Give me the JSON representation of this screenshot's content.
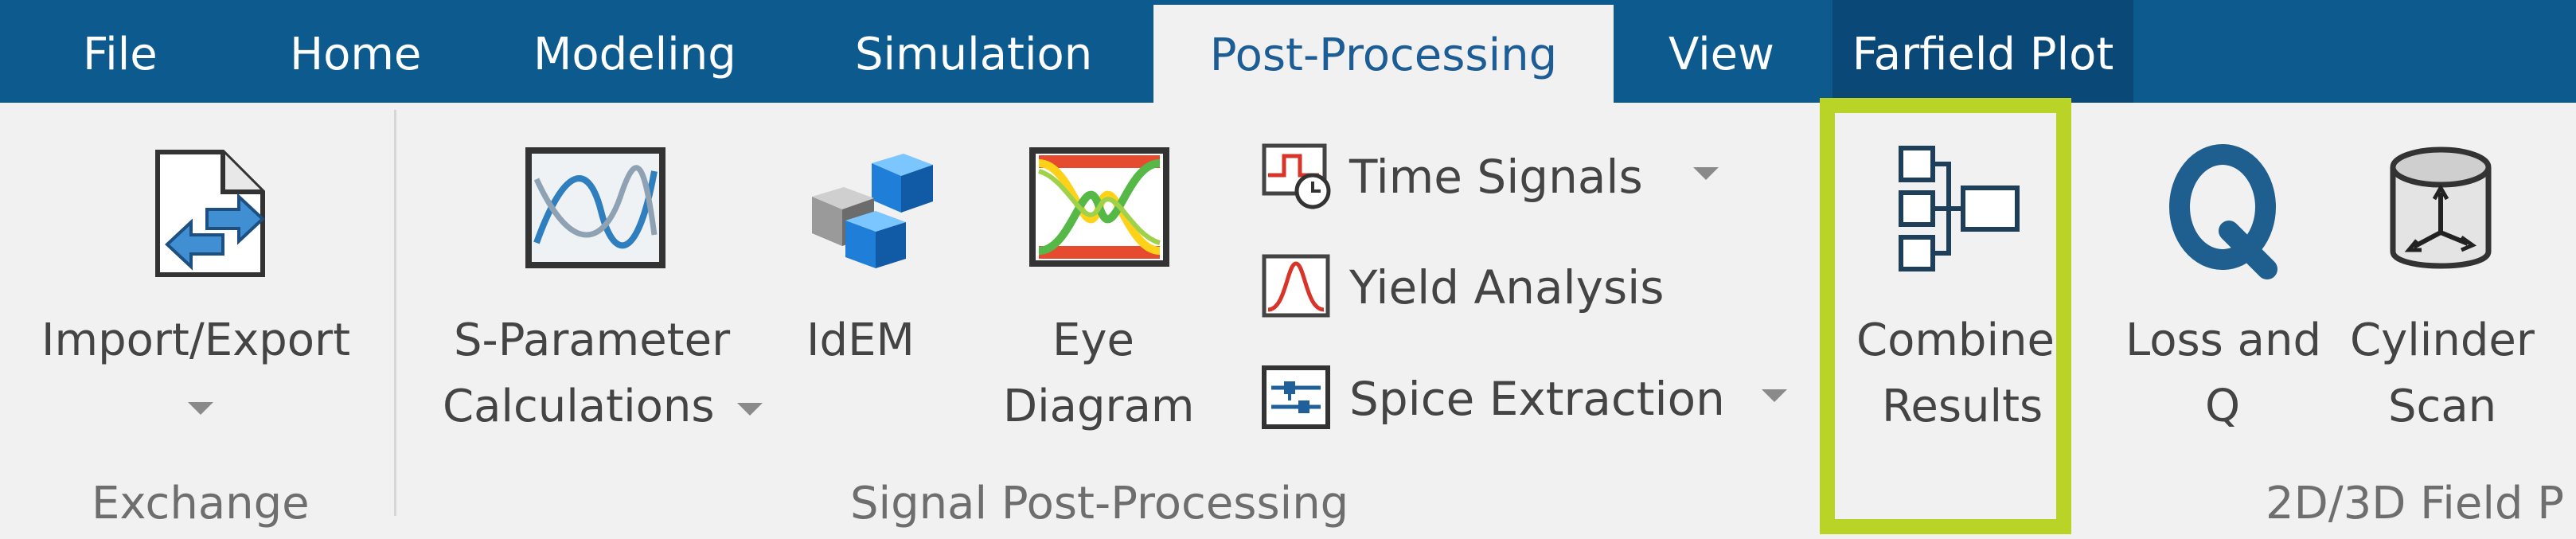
{
  "tabs": [
    {
      "label": "File"
    },
    {
      "label": "Home"
    },
    {
      "label": "Modeling"
    },
    {
      "label": "Simulation"
    },
    {
      "label": "Post-Processing"
    },
    {
      "label": "View"
    },
    {
      "label": "Farfield Plot"
    }
  ],
  "active_tab": "Post-Processing",
  "groups": {
    "exchange": {
      "label": "Exchange",
      "import_export": {
        "line1": "Import/Export",
        "icon": "import-export-icon"
      }
    },
    "signal": {
      "label": "Signal Post-Processing",
      "s_parameter": {
        "line1": "S-Parameter",
        "line2": "Calculations",
        "icon": "s-parameter-chart-icon"
      },
      "idem": {
        "line1": "IdEM",
        "icon": "idem-cubes-icon"
      },
      "eye": {
        "line1": "Eye",
        "line2": "Diagram",
        "icon": "eye-diagram-icon"
      },
      "time_signals": {
        "label": "Time Signals",
        "icon": "time-signals-icon"
      },
      "yield": {
        "label": "Yield Analysis",
        "icon": "yield-analysis-icon"
      },
      "spice": {
        "label": "Spice Extraction",
        "icon": "spice-extraction-icon"
      }
    },
    "field": {
      "label": "2D/3D Field P",
      "combine": {
        "line1": "Combine",
        "line2": "Results",
        "icon": "combine-results-icon"
      },
      "loss": {
        "line1": "Loss and",
        "line2": "Q",
        "icon": "loss-q-icon"
      },
      "cylinder": {
        "line1": "Cylinder",
        "line2": "Scan",
        "icon": "cylinder-scan-icon"
      }
    }
  },
  "colors": {
    "tab_bar": "#0d5a8f",
    "ribbon_bg": "#f2f1f1",
    "active_tab_text": "#1d5d95",
    "highlight": "#b9d327"
  }
}
